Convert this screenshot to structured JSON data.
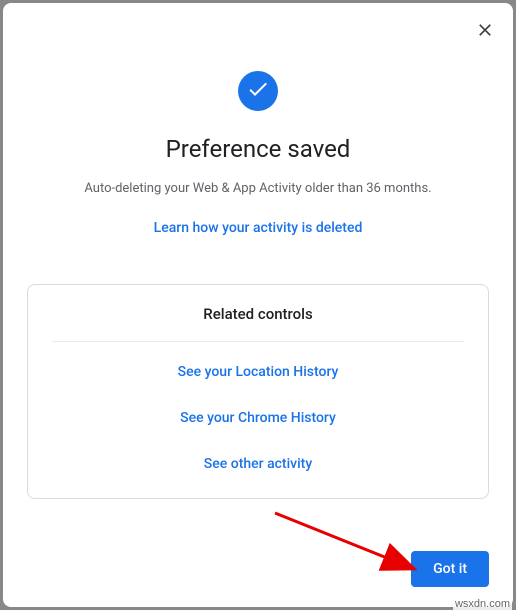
{
  "dialog": {
    "title": "Preference saved",
    "subtitle": "Auto-deleting your Web & App Activity older than 36 months.",
    "learn_link": "Learn how your activity is deleted"
  },
  "card": {
    "title": "Related controls",
    "links": {
      "location": "See your Location History",
      "chrome": "See your Chrome History",
      "other": "See other activity"
    }
  },
  "footer": {
    "got_it": "Got it"
  },
  "watermark": "wsxdn.com",
  "colors": {
    "primary": "#1a73e8",
    "text_primary": "#202124",
    "text_secondary": "#5f6368"
  }
}
